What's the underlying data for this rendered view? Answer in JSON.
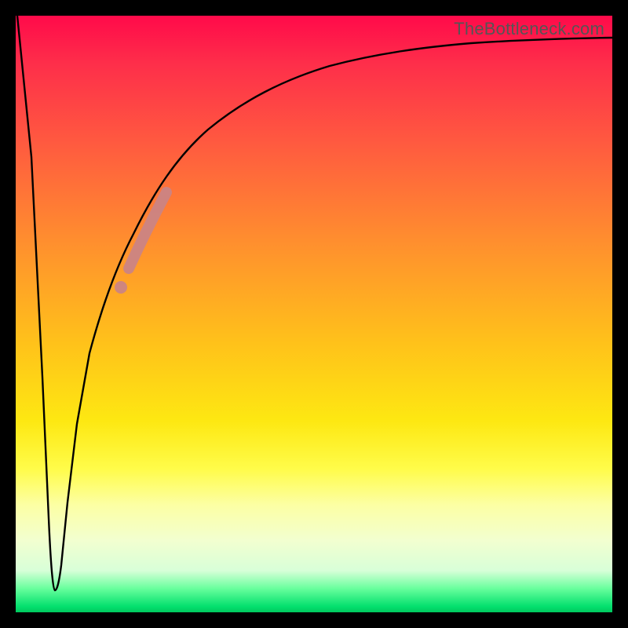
{
  "watermark": "TheBottleneck.com",
  "colors": {
    "curve": "#000000",
    "highlight": "#cb8484",
    "gradient_top": "#ff0a4a",
    "gradient_bottom": "#00c95e",
    "frame": "#000000"
  },
  "chart_data": {
    "type": "line",
    "title": "",
    "xlabel": "",
    "ylabel": "",
    "xlim": [
      0,
      100
    ],
    "ylim": [
      0,
      100
    ],
    "grid": false,
    "legend": false,
    "note": "Values estimated from pixel positions; y increases upward (100 = top). Curve plunges from top-left to a minimum near x≈6 then rises asymptotically toward the top.",
    "series": [
      {
        "name": "bottleneck-curve",
        "x": [
          0,
          2,
          4,
          5,
          6,
          7,
          8,
          9,
          10,
          12,
          14,
          16,
          18,
          20,
          22,
          25,
          28,
          32,
          36,
          40,
          45,
          50,
          55,
          60,
          65,
          70,
          75,
          80,
          85,
          90,
          95,
          100
        ],
        "y": [
          100,
          70,
          30,
          10,
          3,
          4,
          12,
          20,
          28,
          40,
          49,
          55,
          60,
          64,
          67,
          71,
          75,
          79,
          82,
          84,
          86.5,
          88.5,
          90,
          91.2,
          92.2,
          93,
          93.7,
          94.3,
          94.8,
          95.2,
          95.6,
          96
        ]
      }
    ],
    "highlight_segment": {
      "description": "thick pink/salmon highlighted portion of the curve",
      "x_range": [
        18,
        25
      ],
      "y_range": [
        56,
        72
      ]
    },
    "highlight_dot": {
      "x": 17.2,
      "y": 54
    }
  }
}
